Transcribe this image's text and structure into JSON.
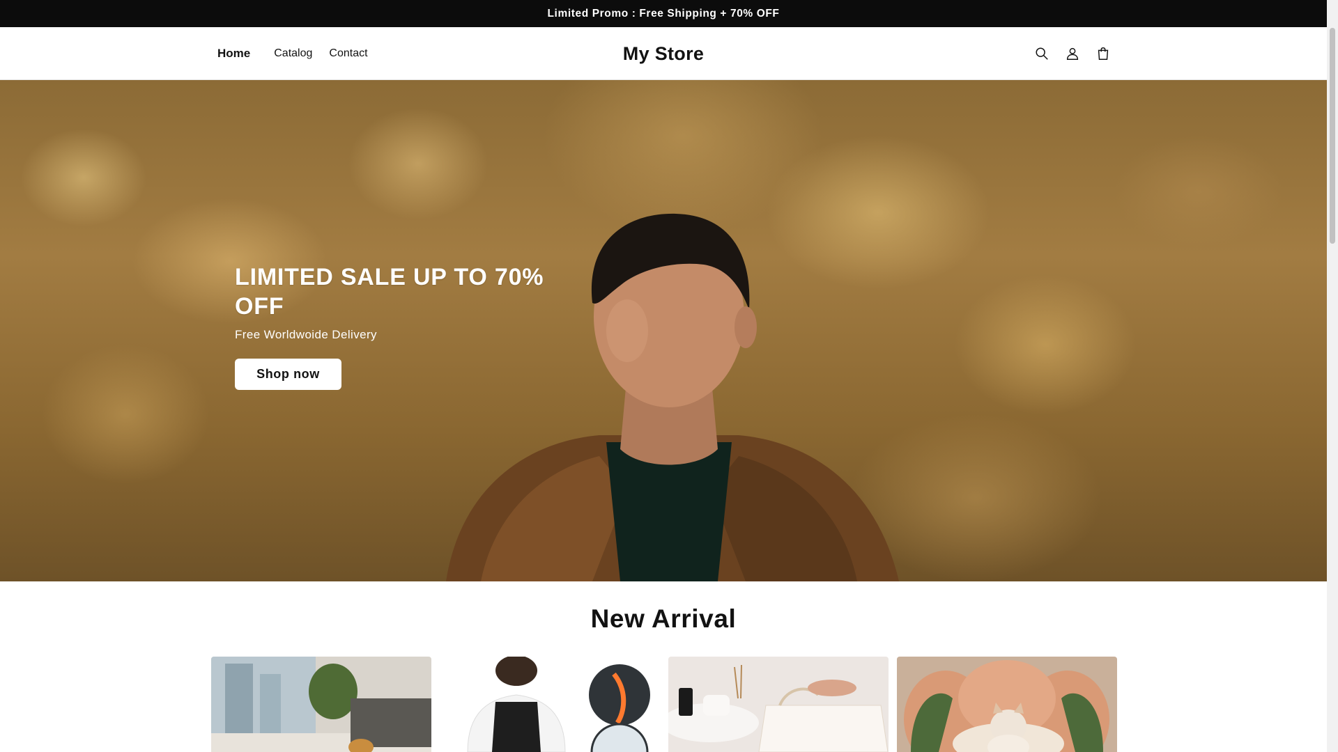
{
  "announcement": {
    "text": "Limited Promo : Free Shipping + 70% OFF"
  },
  "header": {
    "logo": "My Store",
    "nav": [
      {
        "label": "Home",
        "active": true
      },
      {
        "label": "Catalog",
        "active": false
      },
      {
        "label": "Contact",
        "active": false
      }
    ],
    "icons": [
      "search-icon",
      "account-icon",
      "cart-icon"
    ]
  },
  "hero": {
    "title": "LIMITED SALE UP TO 70% OFF",
    "subtitle": "Free Worldwoide Delivery",
    "button_label": "Shop now"
  },
  "new_arrival": {
    "title": "New Arrival",
    "products": [
      {
        "image": "living-room-dog-image"
      },
      {
        "image": "posture-corrector-image"
      },
      {
        "image": "makeup-bag-image"
      },
      {
        "image": "cat-bed-image"
      }
    ]
  },
  "colors": {
    "announcement_bg": "#0c0c0c",
    "text": "#121212",
    "hero_button_bg": "#ffffff"
  }
}
